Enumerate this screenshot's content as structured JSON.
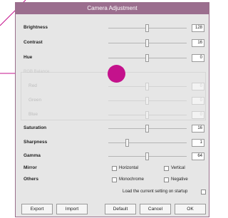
{
  "window": {
    "title": "Camera Adjustment"
  },
  "sliders": {
    "brightness": {
      "label": "Brightness",
      "value": "128"
    },
    "contrast": {
      "label": "Contrast",
      "value": "16"
    },
    "hue": {
      "label": "Hue",
      "value": "0"
    },
    "saturation": {
      "label": "Saturation",
      "value": "16"
    },
    "sharpness": {
      "label": "Sharpness",
      "value": "1"
    },
    "gamma": {
      "label": "Gamma",
      "value": "64"
    }
  },
  "white_balance": {
    "group_label": "RGB Balance",
    "red": {
      "label": "Red",
      "value": "0"
    },
    "green": {
      "label": "Green",
      "value": "0"
    },
    "blue": {
      "label": "Blue",
      "value": "0"
    }
  },
  "mirror": {
    "label": "Mirror",
    "horizontal": "Horizontal",
    "vertical": "Vertical"
  },
  "others": {
    "label": "Others",
    "monochrome": "Monochrome",
    "negative": "Negative"
  },
  "startup": {
    "label": "Load the current setting on startup"
  },
  "buttons": {
    "export": "Export",
    "import": "Import",
    "default": "Default",
    "cancel": "Cancel",
    "ok": "OK"
  },
  "colors": {
    "titlebar": "#9b6e8e",
    "annotation": "#c4128c"
  }
}
